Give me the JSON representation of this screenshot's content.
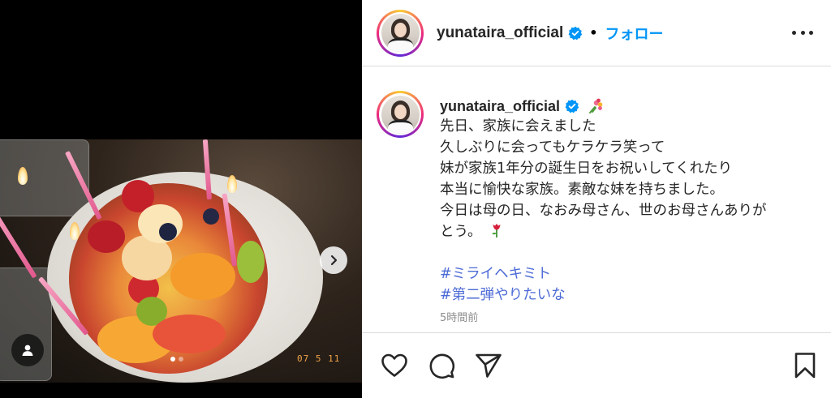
{
  "post": {
    "username": "yunataira_official",
    "separator": "•",
    "follow_label": "フォロー",
    "caption": {
      "username": "yunataira_official",
      "lines": [
        "先日、家族に会えました",
        "久しぶりに会ってもケラケラ笑って",
        "妹が家族1年分の誕生日をお祝いしてくれたり",
        "本当に愉快な家族。素敵な妹を持ちました。",
        "今日は母の日、なおみ母さん、世のお母さんありが",
        "とう。"
      ],
      "hashtags": [
        "#ミライヘキミト",
        "#第二弾やりたいな"
      ],
      "time_ago": "5時間前"
    }
  },
  "media": {
    "photo_timestamp": "07 5 11",
    "carousel_position": 1,
    "carousel_count": 2
  },
  "icons": {
    "verified": "verified-badge-icon",
    "more": "more-options-icon",
    "next": "chevron-right-icon",
    "user_tag": "user-tag-icon",
    "like": "heart-icon",
    "comment": "comment-icon",
    "share": "paper-plane-icon",
    "save": "bookmark-icon",
    "bouquet": "bouquet-emoji",
    "rose": "rose-emoji"
  },
  "colors": {
    "accent": "#0095f6",
    "hashtag": "#4d6bd6",
    "muted": "#8e8e8e",
    "text": "#262626"
  }
}
